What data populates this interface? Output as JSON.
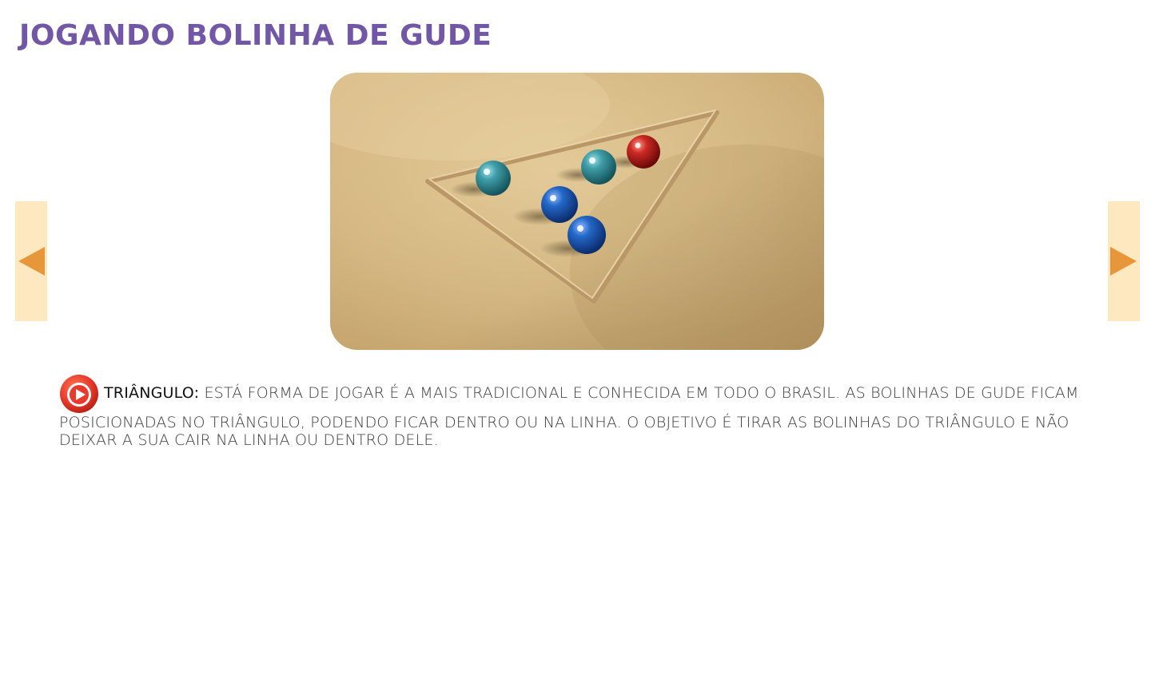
{
  "page": {
    "title": "JOGANDO BOLINHA DE GUDE"
  },
  "navigation": {
    "prev_icon": "triangle-left-icon",
    "next_icon": "triangle-right-icon",
    "button_color": "#fde8c0",
    "arrow_color": "#e8963a"
  },
  "image": {
    "subject": "marbles-in-sand-triangle",
    "sand_color": "#d9bd89",
    "marble_colors": [
      "#2d8a94",
      "#1f5fb5",
      "#1f5fb5",
      "#2d8a94",
      "#c42126"
    ]
  },
  "description": {
    "play_icon": "play-circle-icon",
    "term": "TRIÂNGULO",
    "separator": ":",
    "line1_text": " ESTÁ FORMA DE JOGAR É A MAIS TRADICIONAL E CONHECIDA EM TODO O BRASIL. AS BOLINHAS DE GUDE FICAM",
    "rest_text": "POSICIONADAS NO TRIÂNGULO, PODENDO FICAR DENTRO OU NA LINHA. O OBJETIVO É TIRAR AS BOLINHAS DO TRIÂNGULO E NÃO DEIXAR A SUA CAIR NA LINHA OU DENTRO DELE."
  },
  "colors": {
    "title": "#7257a6",
    "play_button": "#e8392b"
  }
}
